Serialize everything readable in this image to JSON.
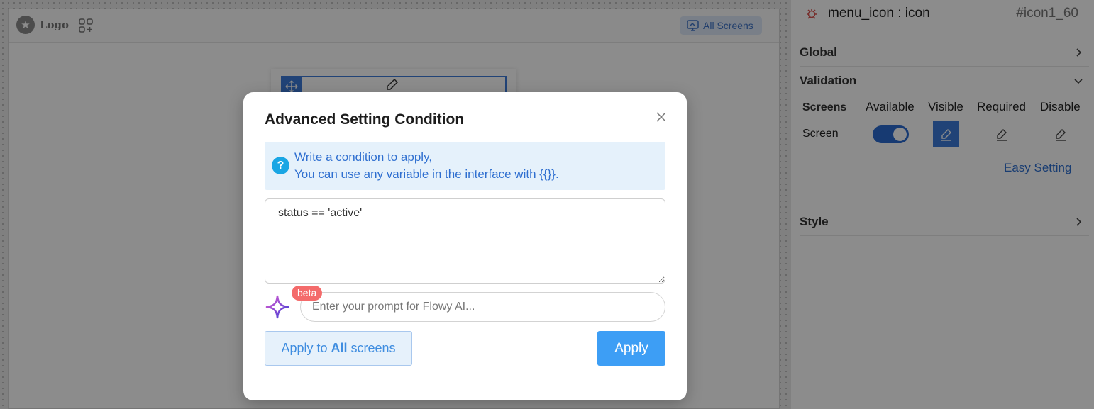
{
  "canvas": {
    "logo_text": "Logo",
    "screens_button_label": "All Screens"
  },
  "panel": {
    "component_name": "menu_icon : icon",
    "component_id": "#icon1_60",
    "sections": {
      "global": "Global",
      "validation": "Validation",
      "style": "Style"
    },
    "validation": {
      "columns": [
        "Screens",
        "Available",
        "Visible",
        "Required",
        "Disable"
      ],
      "row_label": "Screen",
      "available_on": true,
      "easy_setting_label": "Easy Setting"
    }
  },
  "modal": {
    "title": "Advanced Setting Condition",
    "info_line_1": "Write a condition to apply,",
    "info_line_2": "You can use any variable in the interface with {{}}.",
    "condition_value": "status == 'active'",
    "beta_label": "beta",
    "prompt_placeholder": "Enter your prompt for Flowy AI...",
    "apply_all_prefix": "Apply to",
    "apply_all_bold": "All",
    "apply_all_suffix": "screens",
    "apply_label": "Apply"
  },
  "colors": {
    "accent": "#3d7ad9",
    "primary_button": "#3d9ef5",
    "beta_badge": "#f46b6b",
    "info_bg": "#e5f1fb"
  }
}
